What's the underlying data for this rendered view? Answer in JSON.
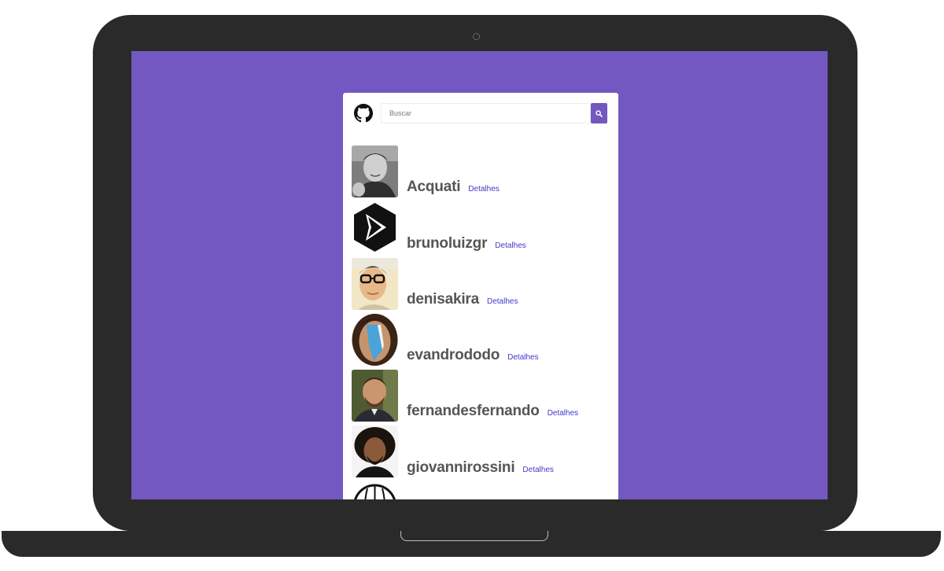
{
  "search": {
    "placeholder": "Buscar"
  },
  "icons": {
    "logo": "github-icon",
    "search": "search-icon"
  },
  "colors": {
    "accent": "#7458c1",
    "link": "#4338ca",
    "username": "#555555"
  },
  "users": [
    {
      "login": "Acquati",
      "link_label": "Detalhes"
    },
    {
      "login": "brunoluizgr",
      "link_label": "Detalhes"
    },
    {
      "login": "denisakira",
      "link_label": "Detalhes"
    },
    {
      "login": "evandrododo",
      "link_label": "Detalhes"
    },
    {
      "login": "fernandesfernando",
      "link_label": "Detalhes"
    },
    {
      "login": "giovannirossini",
      "link_label": "Detalhes"
    }
  ]
}
